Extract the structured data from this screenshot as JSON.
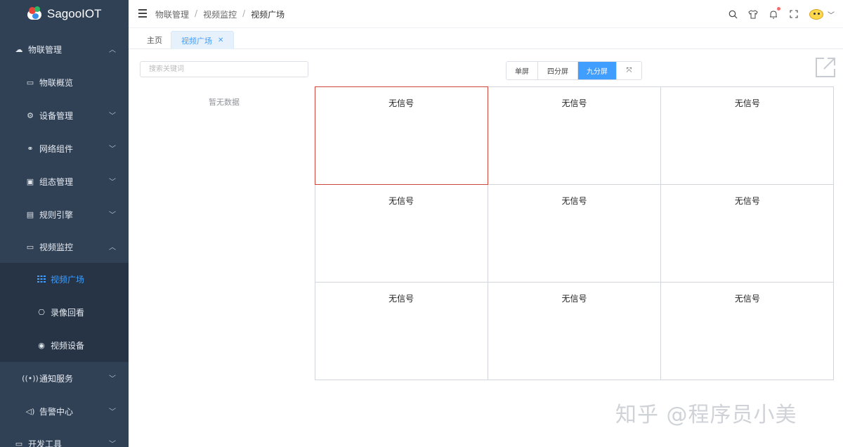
{
  "app": {
    "name": "SagooIOT"
  },
  "sidebar": {
    "items": [
      {
        "label": "物联管理",
        "icon": "cloud-icon",
        "expanded": true
      },
      {
        "label": "物联概览",
        "icon": "monitor-icon"
      },
      {
        "label": "设备管理",
        "icon": "devices-icon"
      },
      {
        "label": "网络组件",
        "icon": "network-icon"
      },
      {
        "label": "组态管理",
        "icon": "config-icon"
      },
      {
        "label": "规则引擎",
        "icon": "rules-icon"
      },
      {
        "label": "视频监控",
        "icon": "video-icon",
        "expanded": true
      },
      {
        "label": "视频广场",
        "icon": "grid-icon",
        "active": true
      },
      {
        "label": "录像回看",
        "icon": "replay-icon"
      },
      {
        "label": "视频设备",
        "icon": "camera-icon"
      },
      {
        "label": "通知服务",
        "icon": "broadcast-icon"
      },
      {
        "label": "告警中心",
        "icon": "speaker-icon"
      },
      {
        "label": "开发工具",
        "icon": "tools-icon"
      }
    ]
  },
  "breadcrumb": [
    "物联管理",
    "视频监控",
    "视频广场"
  ],
  "tabs": [
    {
      "label": "主页"
    },
    {
      "label": "视频广场",
      "active": true
    }
  ],
  "search": {
    "placeholder": "搜索关键词"
  },
  "empty_text": "暂无数据",
  "layout_switch": {
    "single": "单屏",
    "four": "四分屏",
    "nine": "九分屏",
    "close_symbol": "⤧",
    "active": "九分屏"
  },
  "cells": [
    "无信号",
    "无信号",
    "无信号",
    "无信号",
    "无信号",
    "无信号",
    "无信号",
    "无信号",
    "无信号"
  ],
  "watermark": "知乎 @程序员小美",
  "colors": {
    "sidebar_bg": "#304156",
    "accent": "#409eff",
    "selected_border": "#d0463a"
  }
}
